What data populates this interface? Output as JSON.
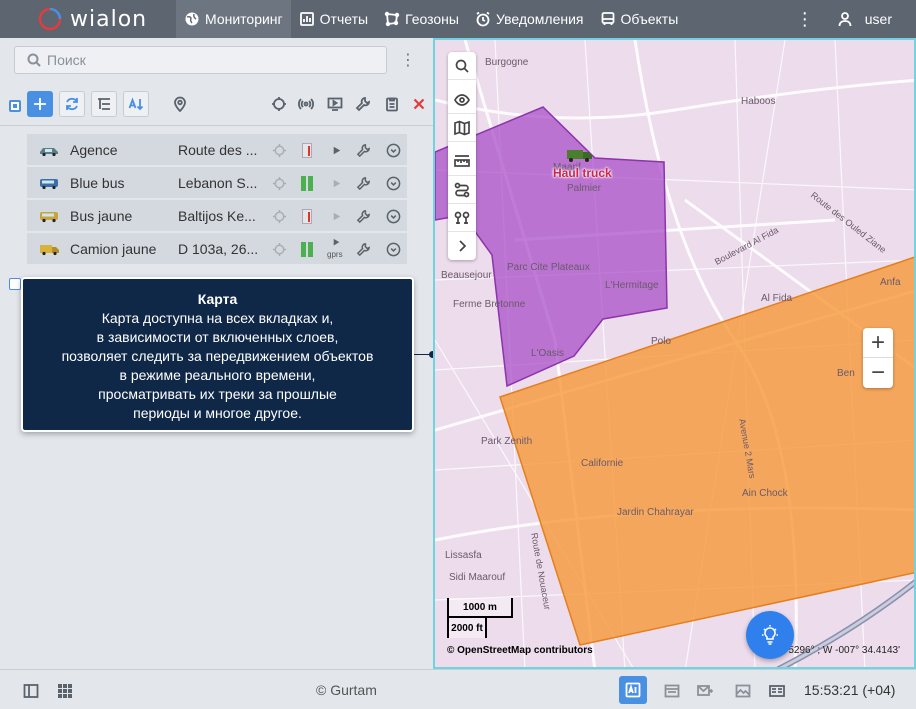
{
  "app": {
    "logo_text": "wialon"
  },
  "nav": {
    "items": [
      {
        "label": "Мониторинг",
        "icon": "globe-icon",
        "active": true
      },
      {
        "label": "Отчеты",
        "icon": "report-icon",
        "active": false
      },
      {
        "label": "Геозоны",
        "icon": "geofence-icon",
        "active": false
      },
      {
        "label": "Уведомления",
        "icon": "alarm-clock-icon",
        "active": false
      },
      {
        "label": "Объекты",
        "icon": "bus-icon",
        "active": false
      }
    ],
    "user": "user"
  },
  "monitoring": {
    "search_placeholder": "Поиск",
    "units": [
      {
        "name": "Agence",
        "address": "Route des ...",
        "battery": "red",
        "play_label": ""
      },
      {
        "name": "Blue bus",
        "address": "Lebanon S...",
        "battery": "green",
        "play_label": ""
      },
      {
        "name": "Bus jaune",
        "address": "Baltijos Ke...",
        "battery": "red",
        "play_label": ""
      },
      {
        "name": "Camion jaune",
        "address": "D 103a, 26...",
        "battery": "green",
        "play_label": "gprs"
      }
    ]
  },
  "tooltip": {
    "title": "Карта",
    "lines": [
      "Карта доступна на всех вкладках и,",
      "в зависимости от включенных слоев,",
      "позволяет следить за передвижением объектов",
      "в режиме реального времени,",
      "просматривать их треки за прошлые",
      "периоды и многое другое."
    ]
  },
  "map": {
    "unit_label": "Haul truck",
    "scale_top": "1000 m",
    "scale_bottom": "2000 ft",
    "attribution": "© OpenStreetMap contributors",
    "coords": "5296° ; W -007° 34.4143'",
    "zoom_in": "+",
    "zoom_out": "−",
    "place_names": [
      "Burgogne",
      "Maarif",
      "Palmier",
      "Parc Cite Plateaux",
      "Beausejour",
      "Ferme Bretonne",
      "L'Hermitage",
      "Polo",
      "L'Oasis",
      "Park Zenith",
      "Californie",
      "Jardin Chahrayar",
      "Ain Chock",
      "Sidi Maarouf",
      "Lissasfa",
      "Al Fida",
      "Ben",
      "Haboos",
      "Anfa",
      "Boulevard Al Fida",
      "Route des Ouled Ziane",
      "Avenue 2 Mars",
      "Route de Nouaceur"
    ],
    "colors": {
      "purple_zone": "#a64bc6",
      "orange_zone": "#f59a3c",
      "map_bg": "#ecdcec"
    }
  },
  "footer": {
    "copyright": "© Gurtam",
    "clock": "15:53:21 (+04)"
  }
}
